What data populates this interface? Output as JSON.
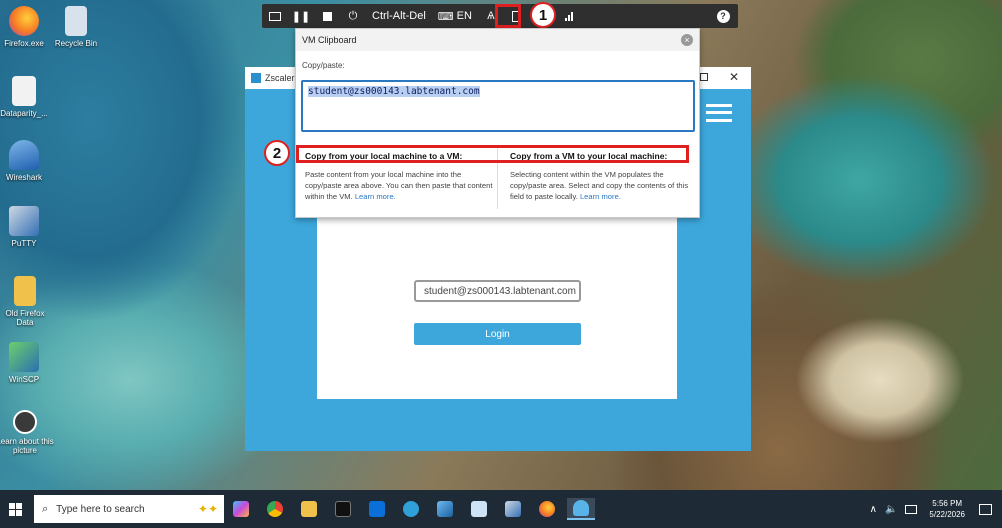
{
  "desktop": {
    "icons": [
      {
        "label": "Firefox.exe",
        "color": "#f57a25"
      },
      {
        "label": "Recycle Bin",
        "color": "#c9d6e4"
      },
      {
        "label": "Dataparity_...",
        "color": "#f2f2f2"
      },
      {
        "label": "Wireshark",
        "color": "#2d77c6"
      },
      {
        "label": "PuTTY",
        "color": "#3470b4"
      },
      {
        "label": "Old Firefox Data",
        "color": "#f1c24b"
      },
      {
        "label": "WinSCP",
        "color": "#4aa14a"
      },
      {
        "label": "Learn about this picture",
        "color": "#3a3a3a"
      }
    ]
  },
  "vm_toolbar": {
    "ctrl_alt_del": "Ctrl-Alt-Del",
    "keyboard_lang": "EN",
    "help": "?"
  },
  "markers": {
    "one": "1",
    "two": "2"
  },
  "zscaler": {
    "title": "Zscaler C",
    "username_value": "student@zs000143.labtenant.com",
    "login_label": "Login"
  },
  "clipboard": {
    "title": "VM Clipboard",
    "close": "×",
    "label": "Copy/paste:",
    "value": "student@zs000143.labtenant.com",
    "left_heading": "Copy from your local machine to a VM:",
    "left_text": "Paste content from your local machine into the copy/paste area above. You can then paste that content within the VM.",
    "right_heading": "Copy from a VM to your local machine:",
    "right_text": "Selecting content within the VM populates the copy/paste area. Select and copy the contents of this field to paste locally.",
    "learn_more": "Learn more."
  },
  "taskbar": {
    "search_placeholder": "Type here to search",
    "time": "5:56 PM",
    "date": "5/22/2026"
  }
}
